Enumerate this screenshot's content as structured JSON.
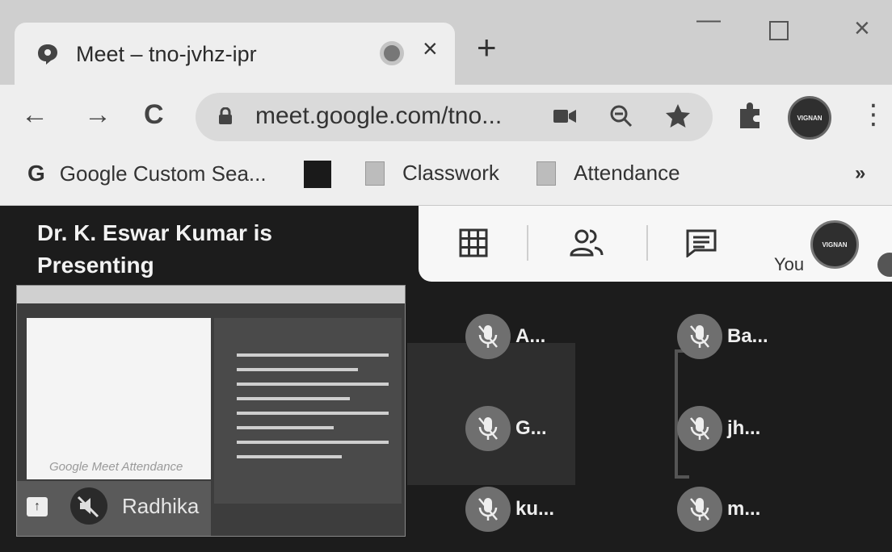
{
  "tab": {
    "title": "Meet – tno-jvhz-ipr",
    "close": "×",
    "new_tab": "+"
  },
  "window": {
    "minimize": "—",
    "close": "×"
  },
  "nav": {
    "back": "←",
    "forward": "→",
    "reload": "C"
  },
  "omnibox": {
    "url": "meet.google.com/tno..."
  },
  "toolbar": {
    "kebab": "⋮",
    "profile_badge": "VIGNAN"
  },
  "bookmarks": {
    "items": [
      {
        "label": "Google Custom Sea...",
        "icon": "google-g-icon"
      },
      {
        "label": "",
        "icon": "bookmark-thumbnail-icon"
      },
      {
        "label": "Classwork",
        "icon": "document-icon"
      },
      {
        "label": "Attendance",
        "icon": "document-icon"
      }
    ],
    "more": "»",
    "google_g": "G"
  },
  "meet": {
    "presenter_text": "Dr. K. Eswar Kumar is Presenting",
    "you_label": "You",
    "you_badge": "VIGNAN",
    "shared_screen": {
      "watermark": "Google Meet Attendance",
      "presenter_name": "Radhika",
      "pin_glyph": "↑"
    },
    "participants": [
      {
        "name": "A..."
      },
      {
        "name": "Ba..."
      },
      {
        "name": "G..."
      },
      {
        "name": "jh..."
      },
      {
        "name": "ku..."
      },
      {
        "name": "m..."
      }
    ]
  },
  "colors": {
    "meet_bg": "#1c1c1c",
    "chrome_bg": "#eeeeee",
    "mic_off_bg": "#6f6f6f"
  }
}
